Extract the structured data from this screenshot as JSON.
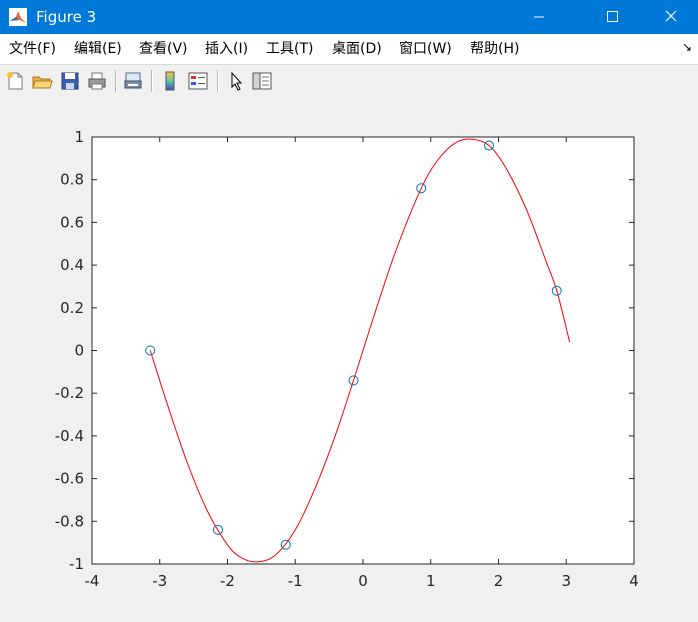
{
  "window": {
    "title": "Figure 3",
    "buttons": [
      "minimize",
      "maximize",
      "close"
    ]
  },
  "menubar": {
    "items": [
      "文件(F)",
      "编辑(E)",
      "查看(V)",
      "插入(I)",
      "工具(T)",
      "桌面(D)",
      "窗口(W)",
      "帮助(H)"
    ]
  },
  "toolbar": {
    "icons": [
      "new-figure-icon",
      "open-file-icon",
      "save-icon",
      "print-icon",
      "link-plot-icon",
      "colorbar-icon",
      "legend-icon",
      "pointer-icon",
      "property-inspector-icon"
    ]
  },
  "colors": {
    "titlebar": "#0078d7",
    "curve": "#ff0000",
    "markers": "#0072bd"
  },
  "chart_data": {
    "type": "line",
    "title": "",
    "xlabel": "",
    "ylabel": "",
    "xlim": [
      -4,
      4
    ],
    "ylim": [
      -1,
      1
    ],
    "x_ticks": [
      -4,
      -3,
      -2,
      -1,
      0,
      1,
      2,
      3,
      4
    ],
    "x_tick_labels": [
      "-4",
      "-3",
      "-2",
      "-1",
      "0",
      "1",
      "2",
      "3",
      "4"
    ],
    "y_ticks": [
      -1,
      -0.8,
      -0.6,
      -0.4,
      -0.2,
      0,
      0.2,
      0.4,
      0.6,
      0.8,
      1
    ],
    "y_tick_labels": [
      "-1",
      "-0.8",
      "-0.6",
      "-0.4",
      "-0.2",
      "0",
      "0.2",
      "0.4",
      "0.6",
      "0.8",
      "1"
    ],
    "grid": false,
    "legend": "none",
    "series": [
      {
        "kind": "markers",
        "marker": "circle",
        "color": "#0072bd",
        "x": [
          -3.14,
          -2.14,
          -1.14,
          -0.14,
          0.86,
          1.86,
          2.86
        ],
        "y": [
          0.0,
          -0.84,
          -0.91,
          -0.14,
          0.76,
          0.96,
          0.28
        ]
      },
      {
        "kind": "curve",
        "color": "#ff0000",
        "x": [
          -3.14,
          -2.9,
          -2.6,
          -2.3,
          -2.0,
          -1.8,
          -1.57,
          -1.3,
          -1.0,
          -0.7,
          -0.4,
          -0.14,
          0.2,
          0.5,
          0.86,
          1.1,
          1.35,
          1.6,
          1.86,
          2.1,
          2.4,
          2.7,
          2.86,
          3.05
        ],
        "y": [
          0.0,
          -0.24,
          -0.52,
          -0.75,
          -0.91,
          -0.97,
          -0.99,
          -0.96,
          -0.84,
          -0.64,
          -0.39,
          -0.14,
          0.2,
          0.48,
          0.76,
          0.89,
          0.97,
          0.99,
          0.96,
          0.86,
          0.67,
          0.42,
          0.28,
          0.04
        ]
      }
    ]
  }
}
